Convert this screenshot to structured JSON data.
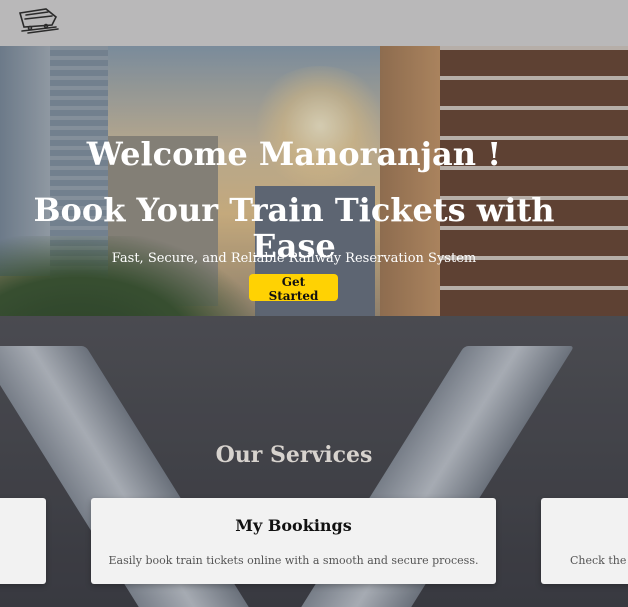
{
  "navbar": {
    "logo_icon": "train-logo-icon"
  },
  "hero": {
    "welcome": "Welcome Manoranjan !",
    "headline": "Book Your Train Tickets with Ease",
    "tagline": "Fast, Secure, and Reliable Railway Reservation System",
    "cta_label": "Get Started"
  },
  "services": {
    "title": "Our Services",
    "cards": [
      {
        "title": "",
        "description": ""
      },
      {
        "title": "My Bookings",
        "description": "Easily book train tickets online with a smooth and secure process."
      },
      {
        "title": "",
        "description": "Check the d"
      }
    ]
  },
  "colors": {
    "navbar_bg": "#b9b8b9",
    "cta_bg": "#ffd203",
    "card_bg": "#f2f2f2"
  }
}
